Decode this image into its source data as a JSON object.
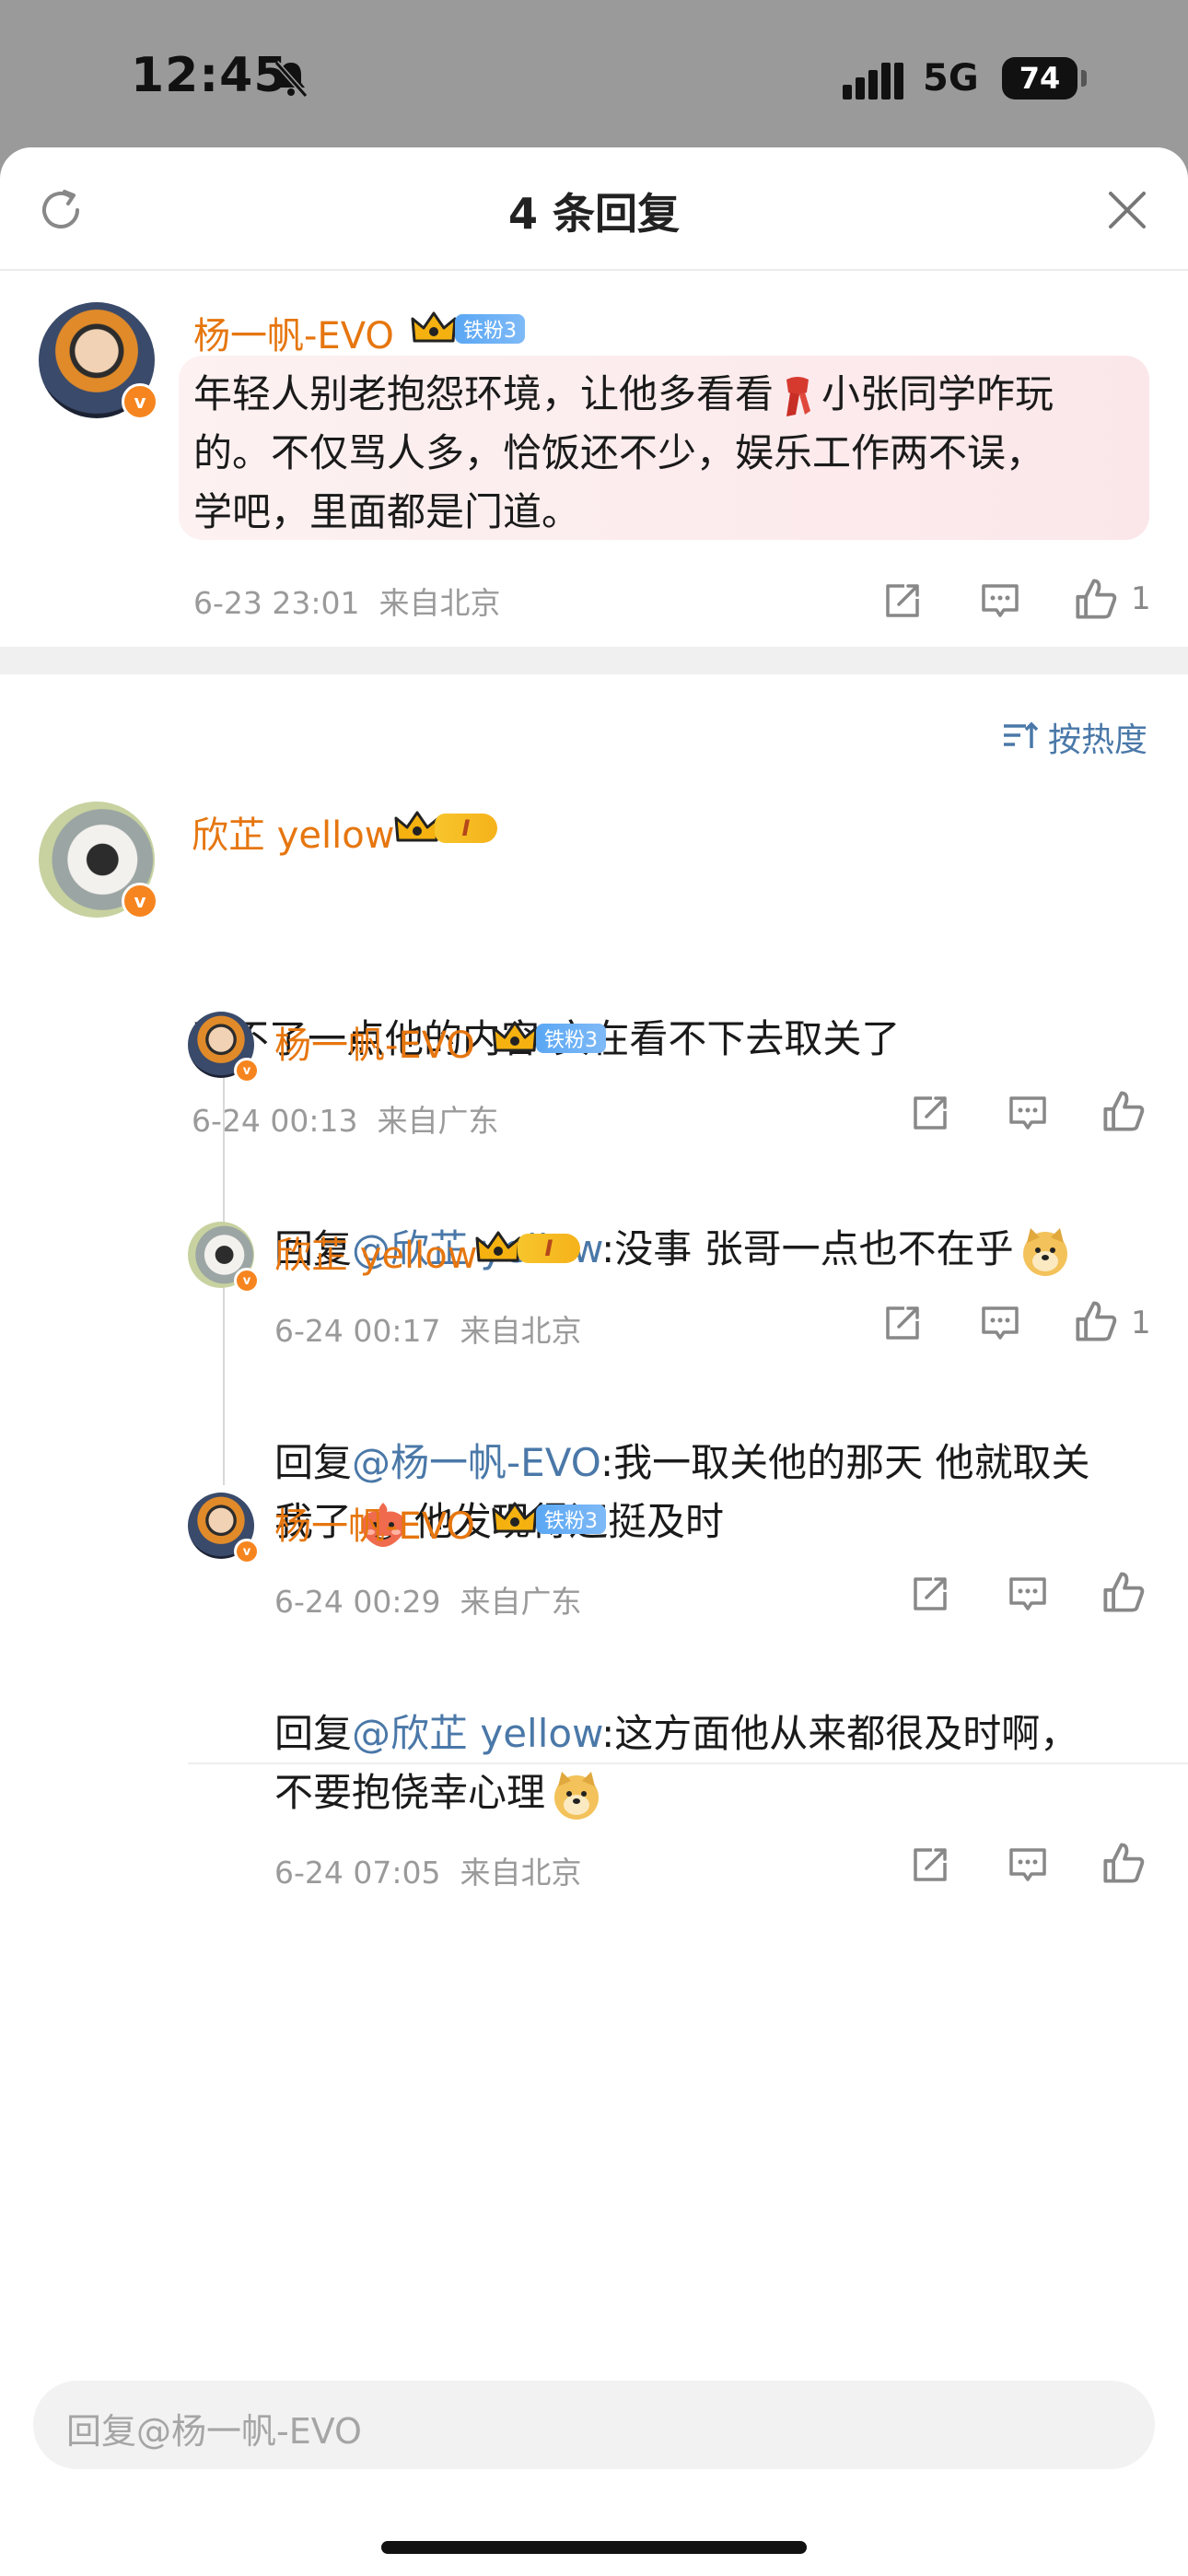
{
  "status_bar": {
    "time": "12:45",
    "network": "5G",
    "battery": "74"
  },
  "header": {
    "title": "4 条回复"
  },
  "root_comment": {
    "username": "杨一帆-EVO",
    "fan_badge": "铁粉3",
    "text_line1_a": "年轻人别老抱怨环境，让他多看看",
    "text_line1_b": "小张同学咋玩",
    "text_line2": "的。不仅骂人多，恰饭还不少，娱乐工作两不误，",
    "text_line3": "学吧，里面都是门道。",
    "time": "6-23 23:01",
    "location": "来自北京",
    "likes": "1"
  },
  "sort": {
    "label": "按热度"
  },
  "main_comment": {
    "username": "欣芷 yellow",
    "level_badge": "I",
    "text": "受不了一点他的内容 实在看不下去取关了",
    "time": "6-24 00:13",
    "location": "来自广东"
  },
  "replies": [
    {
      "username": "杨一帆-EVO",
      "badge": "铁粉3",
      "prefix": "回复",
      "mention": "@欣芷 yellow",
      "text": ":没事 张哥一点也不在乎",
      "time": "6-24 00:17",
      "location": "来自北京",
      "likes": "1"
    },
    {
      "username": "欣芷 yellow",
      "badge": "I",
      "prefix": "回复",
      "mention": "@杨一帆-EVO",
      "text_line1": ":我一取关他的那天 他就取关",
      "text_line2_a": "我了",
      "text_line2_b": "他发现得还挺及时",
      "time": "6-24 00:29",
      "location": "来自广东"
    },
    {
      "username": "杨一帆-EVO",
      "badge": "铁粉3",
      "prefix": "回复",
      "mention": "@欣芷 yellow",
      "text_line1": ":这方面他从来都很及时啊，",
      "text_line2": "不要抱侥幸心理",
      "time": "6-24 07:05",
      "location": "来自北京"
    }
  ],
  "input": {
    "placeholder": "回复@杨一帆-EVO"
  },
  "colors": {
    "username": "#e6760f",
    "mention": "#4a78a8",
    "meta": "#9a9a9a",
    "verified": "#f6851f"
  },
  "icons": [
    "refresh-icon",
    "close-icon",
    "share-icon",
    "comment-icon",
    "like-icon",
    "sort-icon",
    "crown-icon",
    "scarf-emoji",
    "doge-emoji",
    "blush-emoji"
  ]
}
